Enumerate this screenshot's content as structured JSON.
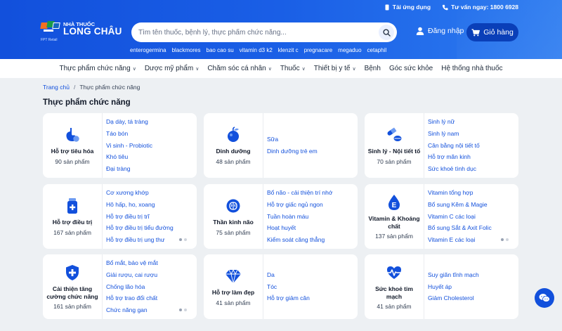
{
  "topbar": {
    "app_label": "Tải ứng dụng",
    "hotline_label": "Tư vấn ngay: 1800 6928"
  },
  "logo": {
    "line1": "NHÀ THUỐC",
    "line2": "LONG CHÂU",
    "sub": "FPT Retail"
  },
  "search": {
    "placeholder": "Tìm tên thuốc, bệnh lý, thực phẩm chức năng..."
  },
  "account": {
    "login_label": "Đăng nhập",
    "cart_label": "Giỏ hàng"
  },
  "keywords": [
    "enterogermina",
    "blackmores",
    "bao cao su",
    "vitamin d3 k2",
    "klenzit c",
    "pregnacare",
    "megaduo",
    "cetaphil"
  ],
  "nav": [
    {
      "label": "Thực phẩm chức năng",
      "dropdown": true
    },
    {
      "label": "Dược mỹ phẩm",
      "dropdown": true
    },
    {
      "label": "Chăm sóc cá nhân",
      "dropdown": true
    },
    {
      "label": "Thuốc",
      "dropdown": true
    },
    {
      "label": "Thiết bị y tế",
      "dropdown": true
    },
    {
      "label": "Bệnh",
      "dropdown": false
    },
    {
      "label": "Góc sức khỏe",
      "dropdown": false
    },
    {
      "label": "Hệ thống nhà thuốc",
      "dropdown": false
    }
  ],
  "breadcrumb": {
    "home": "Trang chủ",
    "sep": "/",
    "current": "Thực phẩm chức năng"
  },
  "page_title": "Thực phẩm chức năng",
  "categories": [
    {
      "name": "Hỗ trợ tiêu hóa",
      "count": "90 sản phẩm",
      "icon": "stomach-icon",
      "links": [
        "Dạ dày, tá tràng",
        "Táo bón",
        "Vi sinh - Probiotic",
        "Khó tiêu",
        "Đại tràng"
      ],
      "dots": false
    },
    {
      "name": "Dinh dưỡng",
      "count": "48 sản phẩm",
      "icon": "nutrition-icon",
      "links": [
        "Sữa",
        "Dinh dưỡng trẻ em"
      ],
      "dots": false
    },
    {
      "name": "Sinh lý - Nội tiết tố",
      "count": "70 sản phẩm",
      "icon": "pills-icon",
      "links": [
        "Sinh lý nữ",
        "Sinh lý nam",
        "Cân bằng nội tiết tố",
        "Hỗ trợ mãn kinh",
        "Sức khoẻ tình dục"
      ],
      "dots": false
    },
    {
      "name": "Hỗ trợ điều trị",
      "count": "167 sản phẩm",
      "icon": "medicine-bottle-icon",
      "links": [
        "Cơ xương khớp",
        "Hô hấp, ho, xoang",
        "Hỗ trợ điều trị trĩ",
        "Hỗ trợ điều trị tiểu đường",
        "Hỗ trợ điều trị ung thư"
      ],
      "dots": true
    },
    {
      "name": "Thần kinh não",
      "count": "75 sản phẩm",
      "icon": "brain-icon",
      "links": [
        "Bổ não - cải thiện trí nhớ",
        "Hỗ trợ giấc ngủ ngon",
        "Tuần hoàn máu",
        "Hoạt huyết",
        "Kiểm soát căng thẳng"
      ],
      "dots": false
    },
    {
      "name": "Vitamin & Khoáng chất",
      "count": "137 sản phẩm",
      "icon": "vitamin-e-icon",
      "links": [
        "Vitamin tổng hợp",
        "Bổ sung Kẽm & Magie",
        "Vitamin C các loại",
        "Bổ sung Sắt & Axit Folic",
        "Vitamin E các loại"
      ],
      "dots": true
    },
    {
      "name": "Cải thiện tăng cường chức năng",
      "count": "161 sản phẩm",
      "icon": "shield-icon",
      "links": [
        "Bổ mắt, bảo vệ mắt",
        "Giải rượu, cai rượu",
        "Chống lão hóa",
        "Hỗ trợ trao đổi chất",
        "Chức năng gan"
      ],
      "dots": true
    },
    {
      "name": "Hỗ trợ làm đẹp",
      "count": "41 sản phẩm",
      "icon": "diamond-icon",
      "links": [
        "Da",
        "Tóc",
        "Hỗ trợ giảm cân"
      ],
      "dots": false
    },
    {
      "name": "Sức khoẻ tim mạch",
      "count": "41 sản phẩm",
      "icon": "heartbeat-icon",
      "links": [
        "Suy giãn tĩnh mạch",
        "Huyết áp",
        "Giảm Cholesterol"
      ],
      "dots": false
    }
  ],
  "colors": {
    "brand": "#1250dc",
    "cart": "#0a3fb8",
    "link": "#1250dc"
  }
}
